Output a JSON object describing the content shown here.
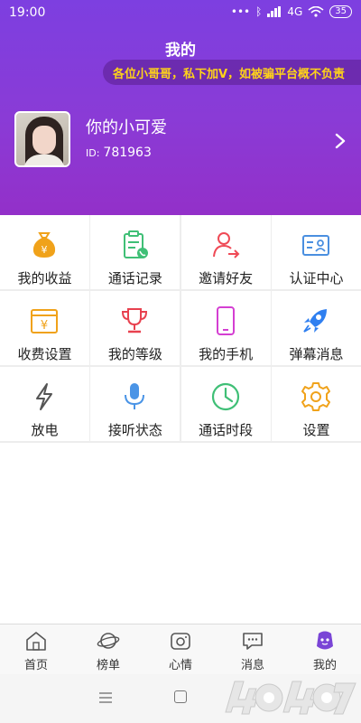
{
  "status_bar": {
    "time": "19:00",
    "network": "4G",
    "battery": "35"
  },
  "header": {
    "title": "我的",
    "marquee": "各位小哥哥，私下加V，如被骗平台概不负责"
  },
  "profile": {
    "nickname": "你的小可爱",
    "id_label": "ID:",
    "id_value": "781963"
  },
  "menu": [
    {
      "label": "我的收益",
      "icon": "money-bag-icon",
      "color": "#f0a21a"
    },
    {
      "label": "通话记录",
      "icon": "clipboard-phone-icon",
      "color": "#3fbf76"
    },
    {
      "label": "邀请好友",
      "icon": "invite-user-icon",
      "color": "#ef4a56"
    },
    {
      "label": "认证中心",
      "icon": "id-card-icon",
      "color": "#4a8fe0"
    },
    {
      "label": "收费设置",
      "icon": "yuan-wallet-icon",
      "color": "#f0a21a"
    },
    {
      "label": "我的等级",
      "icon": "trophy-icon",
      "color": "#e8414f"
    },
    {
      "label": "我的手机",
      "icon": "phone-icon",
      "color": "#d43fd2"
    },
    {
      "label": "弹幕消息",
      "icon": "rocket-icon",
      "color": "#2f7ff0"
    },
    {
      "label": "放电",
      "icon": "lightning-icon",
      "color": "#555555"
    },
    {
      "label": "接听状态",
      "icon": "microphone-icon",
      "color": "#4a94e6"
    },
    {
      "label": "通话时段",
      "icon": "clock-icon",
      "color": "#3fbf76"
    },
    {
      "label": "设置",
      "icon": "gear-icon",
      "color": "#f0a21a"
    }
  ],
  "tabs": [
    {
      "label": "首页",
      "icon": "home-icon"
    },
    {
      "label": "榜单",
      "icon": "planet-icon"
    },
    {
      "label": "心情",
      "icon": "camera-icon"
    },
    {
      "label": "消息",
      "icon": "chat-bubble-icon"
    },
    {
      "label": "我的",
      "icon": "profile-icon",
      "active": true
    }
  ],
  "colors": {
    "header_top": "#7d3fe0",
    "header_bottom": "#9330c9",
    "marquee_text": "#ffd319",
    "active_tab": "#7a45d6"
  }
}
